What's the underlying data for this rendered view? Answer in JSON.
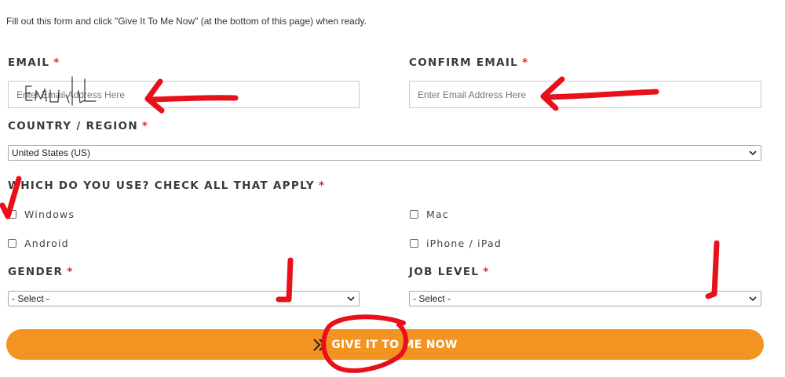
{
  "intro_text": "Fill out this form and click \"Give It To Me Now\" (at the bottom of this page) when ready.",
  "email": {
    "label": "EMAIL",
    "required_mark": "*",
    "placeholder": "Enter Email Address Here",
    "handwritten_note": "Email"
  },
  "confirm_email": {
    "label": "CONFIRM EMAIL",
    "required_mark": "*",
    "placeholder": "Enter Email Address Here"
  },
  "country": {
    "label": "COUNTRY / REGION",
    "required_mark": "*",
    "selected": "United States (US)"
  },
  "devices": {
    "label": "WHICH DO YOU USE? CHECK ALL THAT APPLY",
    "required_mark": "*",
    "options": [
      "Windows",
      "Mac",
      "Android",
      "iPhone / iPad"
    ]
  },
  "gender": {
    "label": "GENDER",
    "required_mark": "*",
    "selected": "- Select -"
  },
  "job_level": {
    "label": "JOB LEVEL",
    "required_mark": "*",
    "selected": "- Select -"
  },
  "submit": {
    "label": "GIVE IT TO ME NOW"
  },
  "colors": {
    "accent_orange": "#f39321",
    "required_red": "#e0262b",
    "annotation_red": "#e8101a"
  }
}
